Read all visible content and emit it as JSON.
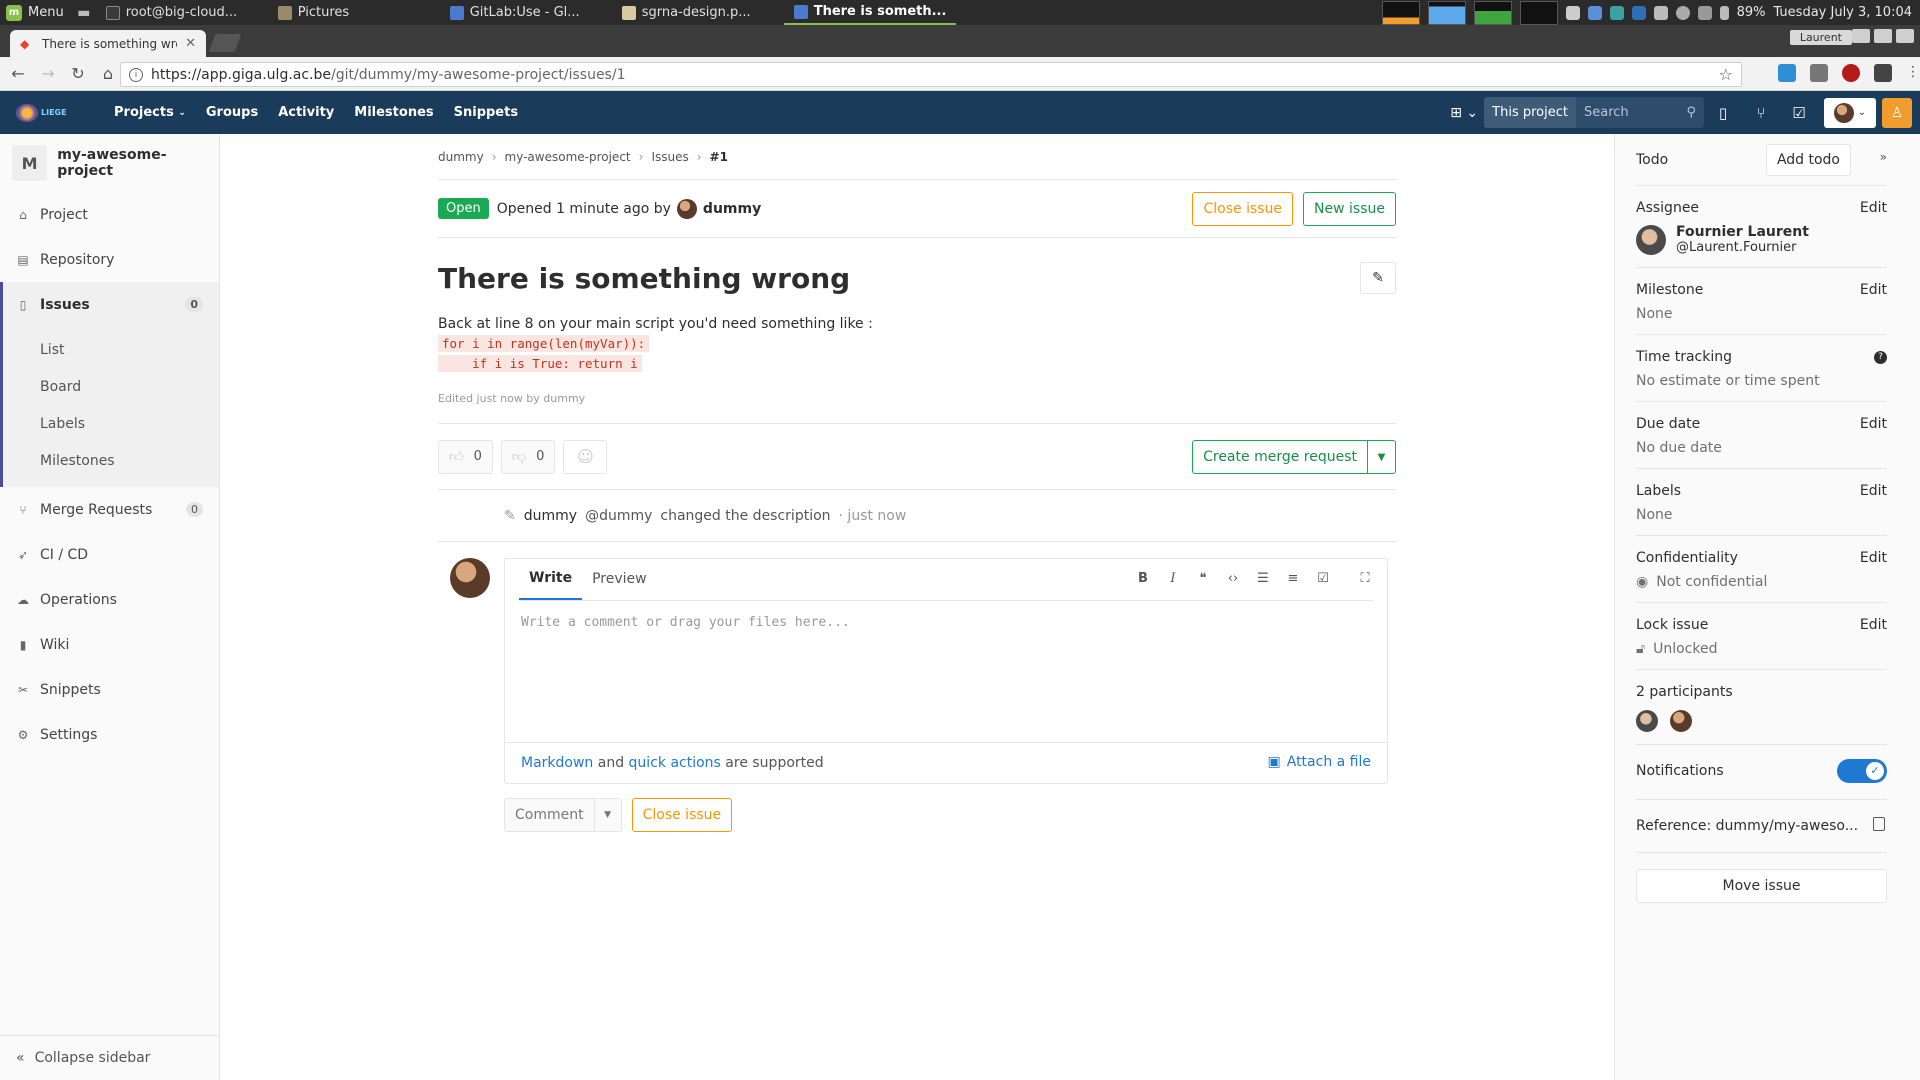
{
  "taskbar": {
    "menu_label": "Menu",
    "tasks": [
      {
        "label": "root@big-cloud...",
        "color": "#3a3a3a"
      },
      {
        "label": "Pictures",
        "color": "#9a8a6a"
      },
      {
        "label": "GitLab:Use - Gl...",
        "color": "#4a7bd1"
      },
      {
        "label": "sgrna-design.p...",
        "color": "#d9c9a3"
      },
      {
        "label": "There is someth...",
        "color": "#4a7bd1"
      }
    ],
    "battery": "89%",
    "clock": "Tuesday July  3, 10:04"
  },
  "browser": {
    "tab_title": "There is something wrong",
    "user_badge": "Laurent",
    "url_host": "https://app.giga.ulg.ac.be",
    "url_path": "/git/dummy/my-awesome-project/issues/1"
  },
  "header": {
    "nav": [
      "Projects",
      "Groups",
      "Activity",
      "Milestones",
      "Snippets"
    ],
    "scope_label": "This project",
    "search_placeholder": "Search"
  },
  "sidebar": {
    "project_initial": "M",
    "project_name": "my-awesome-project",
    "items": {
      "project": "Project",
      "repository": "Repository",
      "issues": "Issues",
      "issues_count": "0",
      "merge_requests": "Merge Requests",
      "mr_count": "0",
      "cicd": "CI / CD",
      "operations": "Operations",
      "wiki": "Wiki",
      "snippets": "Snippets",
      "settings": "Settings"
    },
    "sub_items": [
      "List",
      "Board",
      "Labels",
      "Milestones"
    ],
    "collapse": "Collapse sidebar"
  },
  "main": {
    "breadcrumb": [
      "dummy",
      "my-awesome-project",
      "Issues",
      "#1"
    ],
    "status": "Open",
    "opened_text": "Opened 1 minute ago by",
    "author": "dummy",
    "close_issue": "Close issue",
    "new_issue": "New issue",
    "title": "There is something wrong",
    "description": "Back at line 8 on your main script you'd need something like :",
    "code_line1": "for i in range(len(myVar)):",
    "code_line2": "    if i is True: return i",
    "edited": "Edited just now by dummy",
    "thumbs_up": "0",
    "thumbs_down": "0",
    "create_mr": "Create merge request",
    "note_name": "dummy",
    "note_handle": "@dummy",
    "note_text": "changed the description",
    "note_time": "· just now",
    "tab_write": "Write",
    "tab_preview": "Preview",
    "comment_placeholder": "Write a comment or drag your files here...",
    "markdown_link": "Markdown",
    "and_text": "and",
    "quick_actions": "quick actions",
    "supported_text": "are supported",
    "attach_file": "Attach a file",
    "comment_btn": "Comment",
    "close_issue_bottom": "Close issue"
  },
  "right": {
    "todo": "Todo",
    "add_todo": "Add todo",
    "assignee_title": "Assignee",
    "edit": "Edit",
    "assignee_name": "Fournier Laurent",
    "assignee_username": "@Laurent.Fournier",
    "milestone_title": "Milestone",
    "milestone_value": "None",
    "time_title": "Time tracking",
    "time_value": "No estimate or time spent",
    "due_title": "Due date",
    "due_value": "No due date",
    "labels_title": "Labels",
    "labels_value": "None",
    "conf_title": "Confidentiality",
    "conf_value": "Not confidential",
    "lock_title": "Lock issue",
    "lock_value": "Unlocked",
    "participants": "2 participants",
    "notifications": "Notifications",
    "reference": "Reference: dummy/my-aweso...",
    "move_issue": "Move issue"
  },
  "colors": {
    "header_bg": "#1b3b5a",
    "open_green": "#1aaa55",
    "warning_orange": "#fc9403",
    "link_blue": "#1f78d1"
  }
}
